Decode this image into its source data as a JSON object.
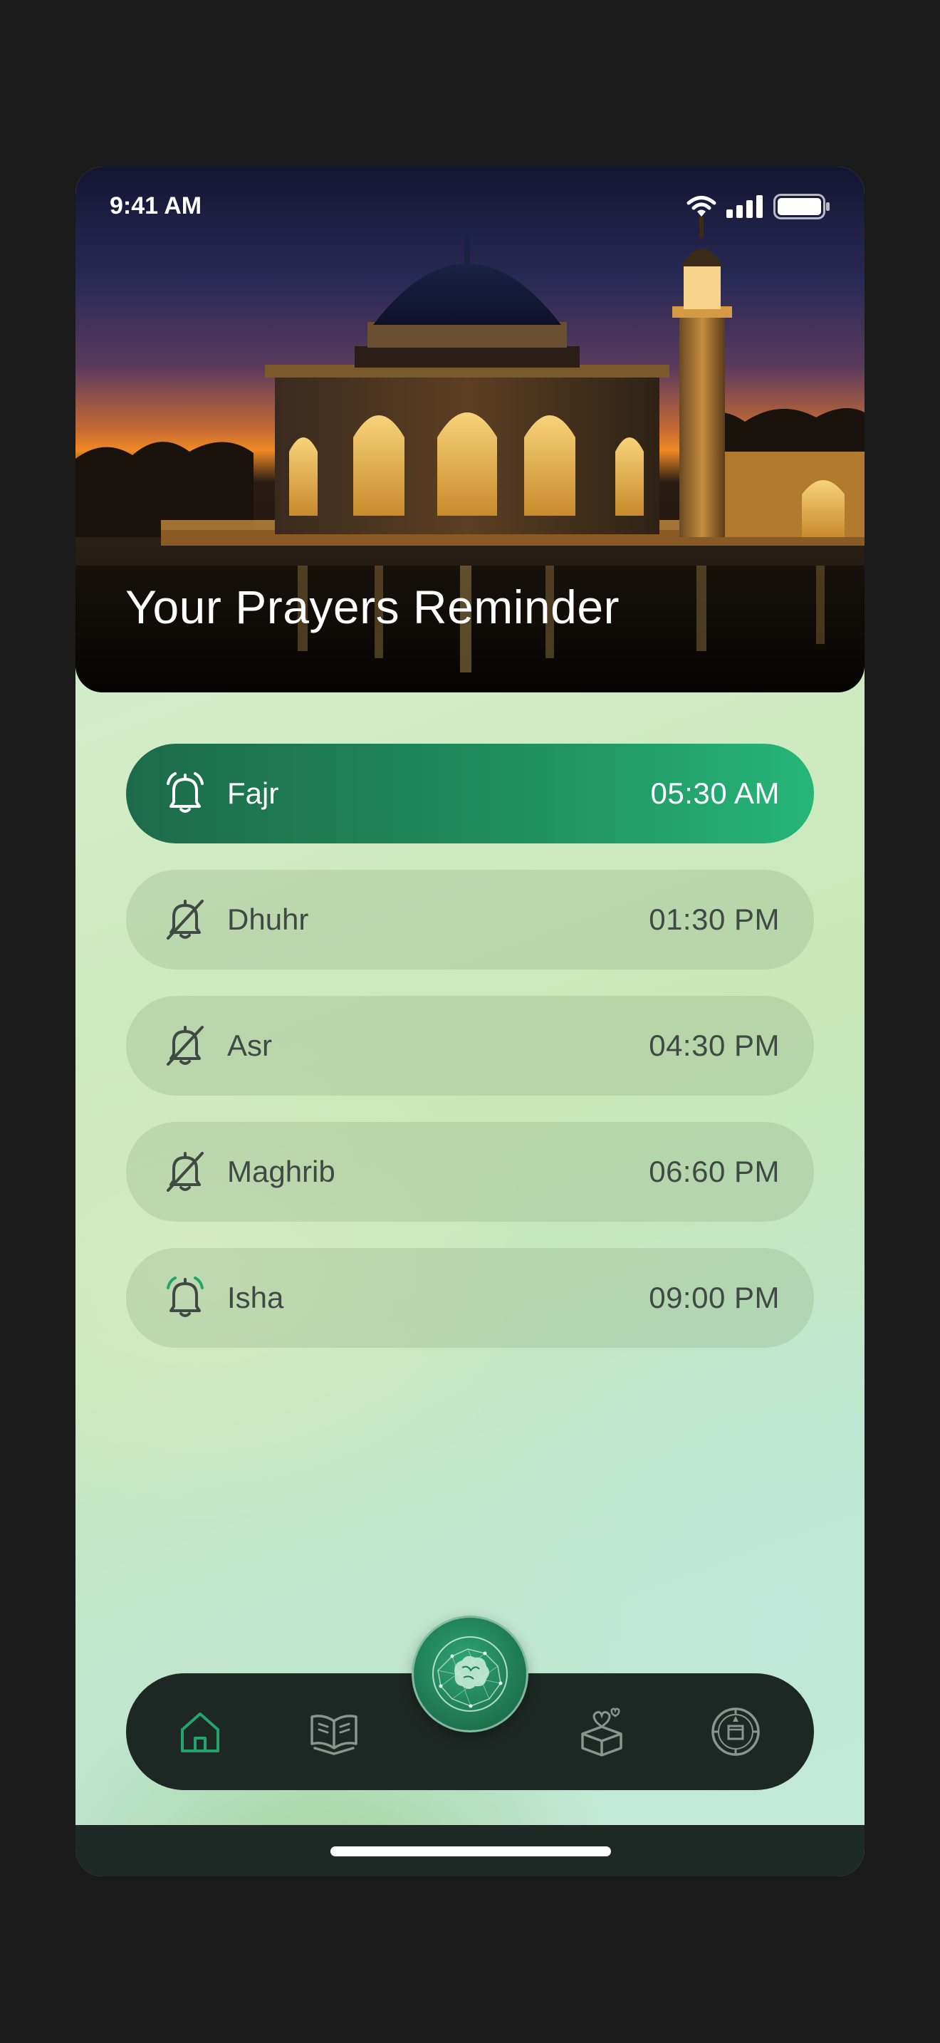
{
  "status_bar": {
    "time": "9:41 AM"
  },
  "hero": {
    "title": "Your Prayers Reminder"
  },
  "prayers": [
    {
      "name": "Fajr",
      "time": "05:30 AM",
      "alarm": "on",
      "active": true
    },
    {
      "name": "Dhuhr",
      "time": "01:30 PM",
      "alarm": "off",
      "active": false
    },
    {
      "name": "Asr",
      "time": "04:30 PM",
      "alarm": "off",
      "active": false
    },
    {
      "name": "Maghrib",
      "time": "06:60 PM",
      "alarm": "off",
      "active": false
    },
    {
      "name": "Isha",
      "time": "09:00 PM",
      "alarm": "ringing",
      "active": false
    }
  ],
  "nav": {
    "items": [
      {
        "icon": "home-icon",
        "selected": true
      },
      {
        "icon": "quran-book-icon",
        "selected": false
      },
      {
        "icon": "globe-brain-icon",
        "selected": false
      },
      {
        "icon": "charity-box-icon",
        "selected": false
      },
      {
        "icon": "kaaba-compass-icon",
        "selected": false
      }
    ]
  },
  "colors": {
    "accent": "#22a56b",
    "active_row_start": "#1d6a4b",
    "active_row_end": "#27b578",
    "nav_background": "#1d2723",
    "text_muted": "#3e4a43"
  }
}
